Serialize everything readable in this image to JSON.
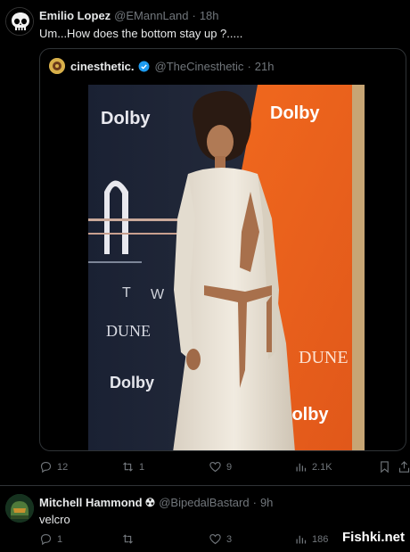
{
  "tweet1": {
    "author_name": "Emilio Lopez",
    "handle": "@EMannLand",
    "time": "18h",
    "text": "Um...How does the bottom stay up ?.....",
    "quote": {
      "author_name": "cinesthetic.",
      "handle": "@TheCinesthetic",
      "time": "21h",
      "photo_signs": [
        "Dolby",
        "Dolby",
        "DUNE",
        "Dolby",
        "DUNE",
        "Dolby"
      ],
      "photo_letters": [
        "T",
        "W"
      ]
    },
    "actions": {
      "replies": "12",
      "reposts": "1",
      "likes": "9",
      "views": "2.1K"
    }
  },
  "tweet2": {
    "author_name": "Mitchell Hammond",
    "author_emoji": "☢",
    "handle": "@BipedalBastard",
    "time": "9h",
    "text": "velcro",
    "actions": {
      "replies": "1",
      "reposts": "",
      "likes": "3",
      "views": "186"
    }
  },
  "watermark": "Fishki.net",
  "colors": {
    "bg": "#000000",
    "text": "#e7e9ea",
    "muted": "#71767b",
    "border": "#2f3336",
    "verified": "#1d9bf0"
  }
}
